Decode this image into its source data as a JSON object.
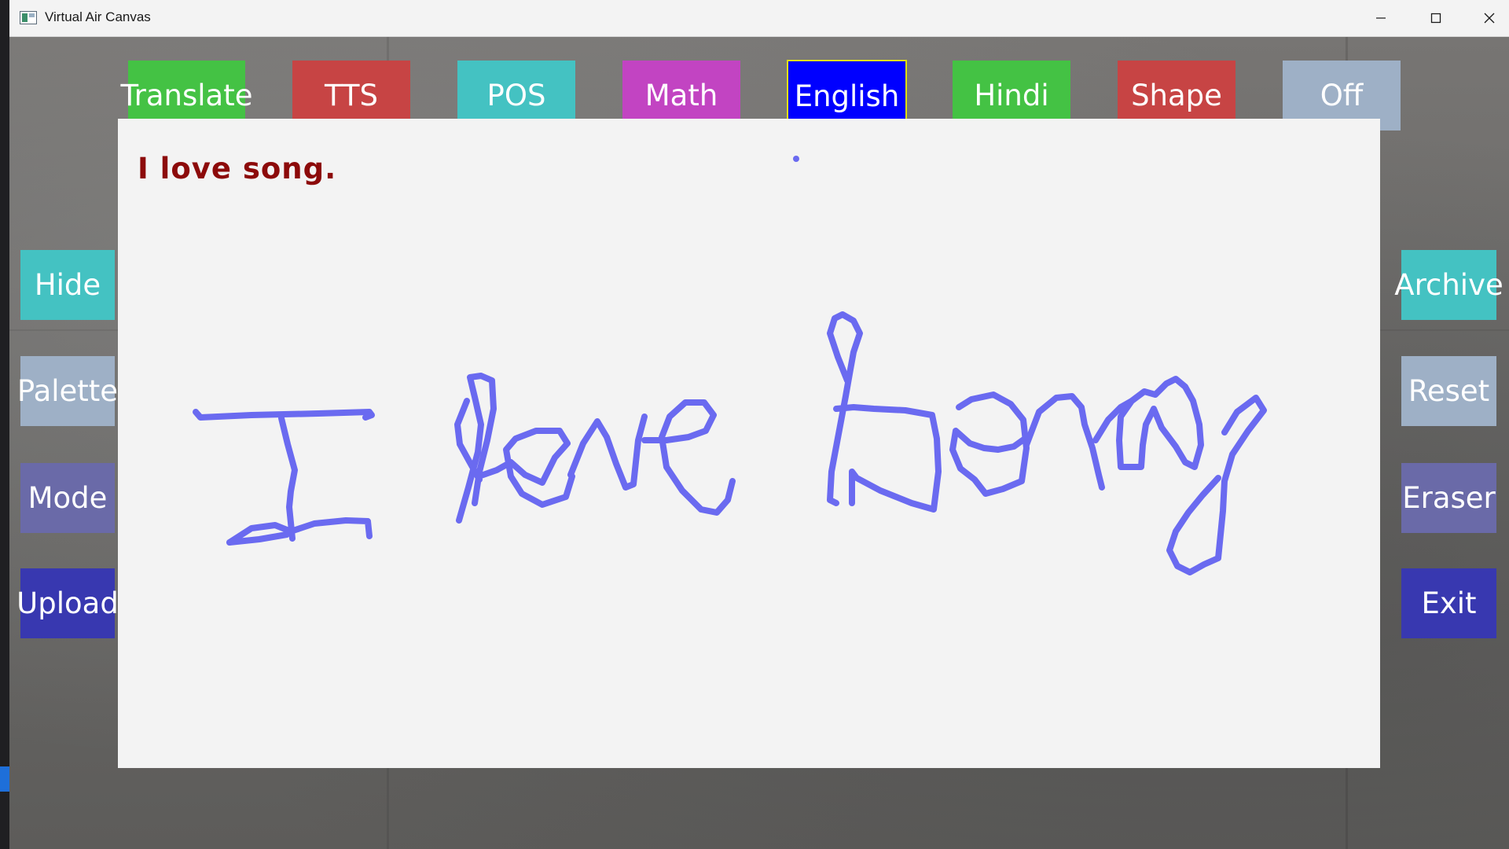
{
  "window": {
    "title": "Virtual Air Canvas",
    "controls": {
      "minimize": "minimize-icon",
      "maximize": "maximize-icon",
      "close": "close-icon"
    }
  },
  "top_buttons": [
    {
      "label": "Translate",
      "color": "#44c244"
    },
    {
      "label": "TTS",
      "color": "#c74444"
    },
    {
      "label": "POS",
      "color": "#44c2c2"
    },
    {
      "label": "Math",
      "color": "#c244c2"
    },
    {
      "label": "English",
      "color": "#0000ff",
      "selected": true,
      "border": "#e0e000"
    },
    {
      "label": "Hindi",
      "color": "#44c244"
    },
    {
      "label": "Shape",
      "color": "#c74444"
    },
    {
      "label": "Off",
      "color": "#9eb0c6"
    }
  ],
  "left_buttons": [
    {
      "label": "Hide",
      "color": "#44c2c2"
    },
    {
      "label": "Palette",
      "color": "#9eb0c6"
    },
    {
      "label": "Mode",
      "color": "#6a6aa8"
    },
    {
      "label": "Upload",
      "color": "#3838b0"
    }
  ],
  "right_buttons": [
    {
      "label": "Archive",
      "color": "#44c2c2"
    },
    {
      "label": "Reset",
      "color": "#9eb0c6"
    },
    {
      "label": "Eraser",
      "color": "#6a6aa8"
    },
    {
      "label": "Exit",
      "color": "#3838b0"
    }
  ],
  "canvas": {
    "recognized_text": "I love song.",
    "recognized_text_color": "#8c0a0a",
    "stroke_color": "#6a6af0",
    "handwriting": "I love song"
  }
}
